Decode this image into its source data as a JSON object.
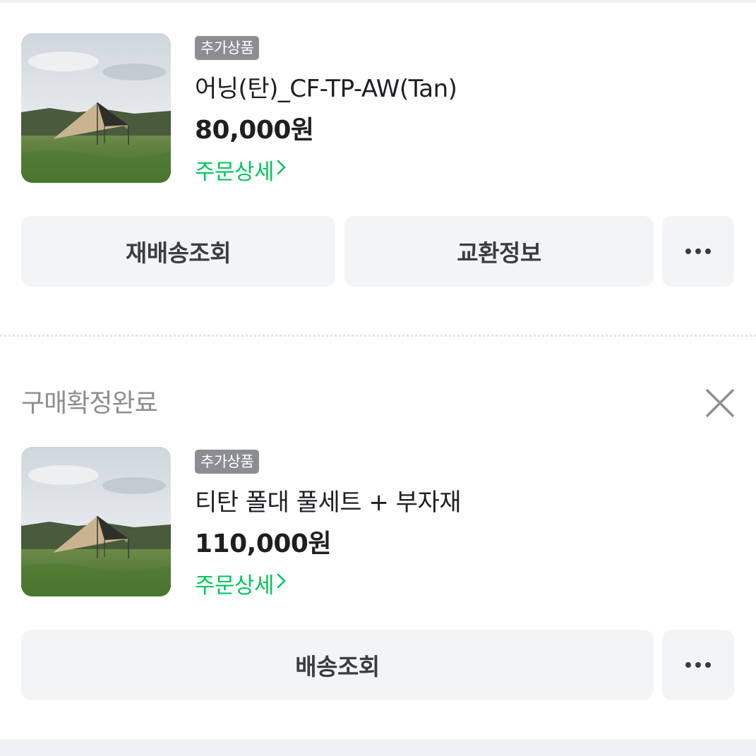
{
  "orders": [
    {
      "badge": "추가상품",
      "product_name": "어닝(탄)_CF-TP-AW(Tan)",
      "price": "80,000원",
      "detail_link": "주문상세",
      "buttons": [
        "재배송조회",
        "교환정보"
      ],
      "more_icon": "more-horizontal-icon"
    },
    {
      "status": "구매확정완료",
      "close_icon": "close-icon",
      "badge": "추가상품",
      "product_name": "티탄 폴대 풀세트 + 부자재",
      "price": "110,000원",
      "detail_link": "주문상세",
      "buttons": [
        "배송조회"
      ],
      "more_icon": "more-horizontal-icon"
    }
  ],
  "colors": {
    "accent_green": "#03c75a",
    "button_bg": "#f3f4f6",
    "badge_bg": "#8c8d92",
    "muted_text": "#8c8d92"
  }
}
